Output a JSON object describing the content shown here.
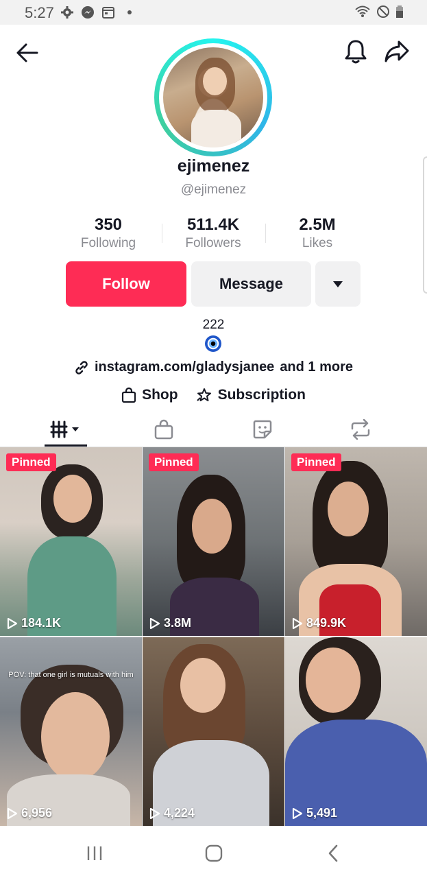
{
  "status_bar": {
    "time": "5:27"
  },
  "profile": {
    "display_name": "ejimenez",
    "handle": "@ejimenez",
    "stats": [
      {
        "value": "350",
        "label": "Following"
      },
      {
        "value": "511.4K",
        "label": "Followers"
      },
      {
        "value": "2.5M",
        "label": "Likes"
      }
    ],
    "follow_label": "Follow",
    "message_label": "Message",
    "bio": "222",
    "link_text": "instagram.com/gladysjanee",
    "link_more": "and 1 more",
    "shop_label": "Shop",
    "subscription_label": "Subscription"
  },
  "tabs": [
    "videos-icon",
    "bag-icon",
    "sticker-icon",
    "repost-icon"
  ],
  "videos": [
    {
      "pinned": "Pinned",
      "views": "184.1K"
    },
    {
      "pinned": "Pinned",
      "views": "3.8M"
    },
    {
      "pinned": "Pinned",
      "views": "849.9K"
    },
    {
      "pinned": "",
      "views": "6,956",
      "overlay": "POV: that one girl is mutuals with him"
    },
    {
      "pinned": "",
      "views": "4,224"
    },
    {
      "pinned": "",
      "views": "5,491"
    }
  ],
  "colors": {
    "accent": "#fe2c55",
    "ring": "#25f4ee"
  }
}
